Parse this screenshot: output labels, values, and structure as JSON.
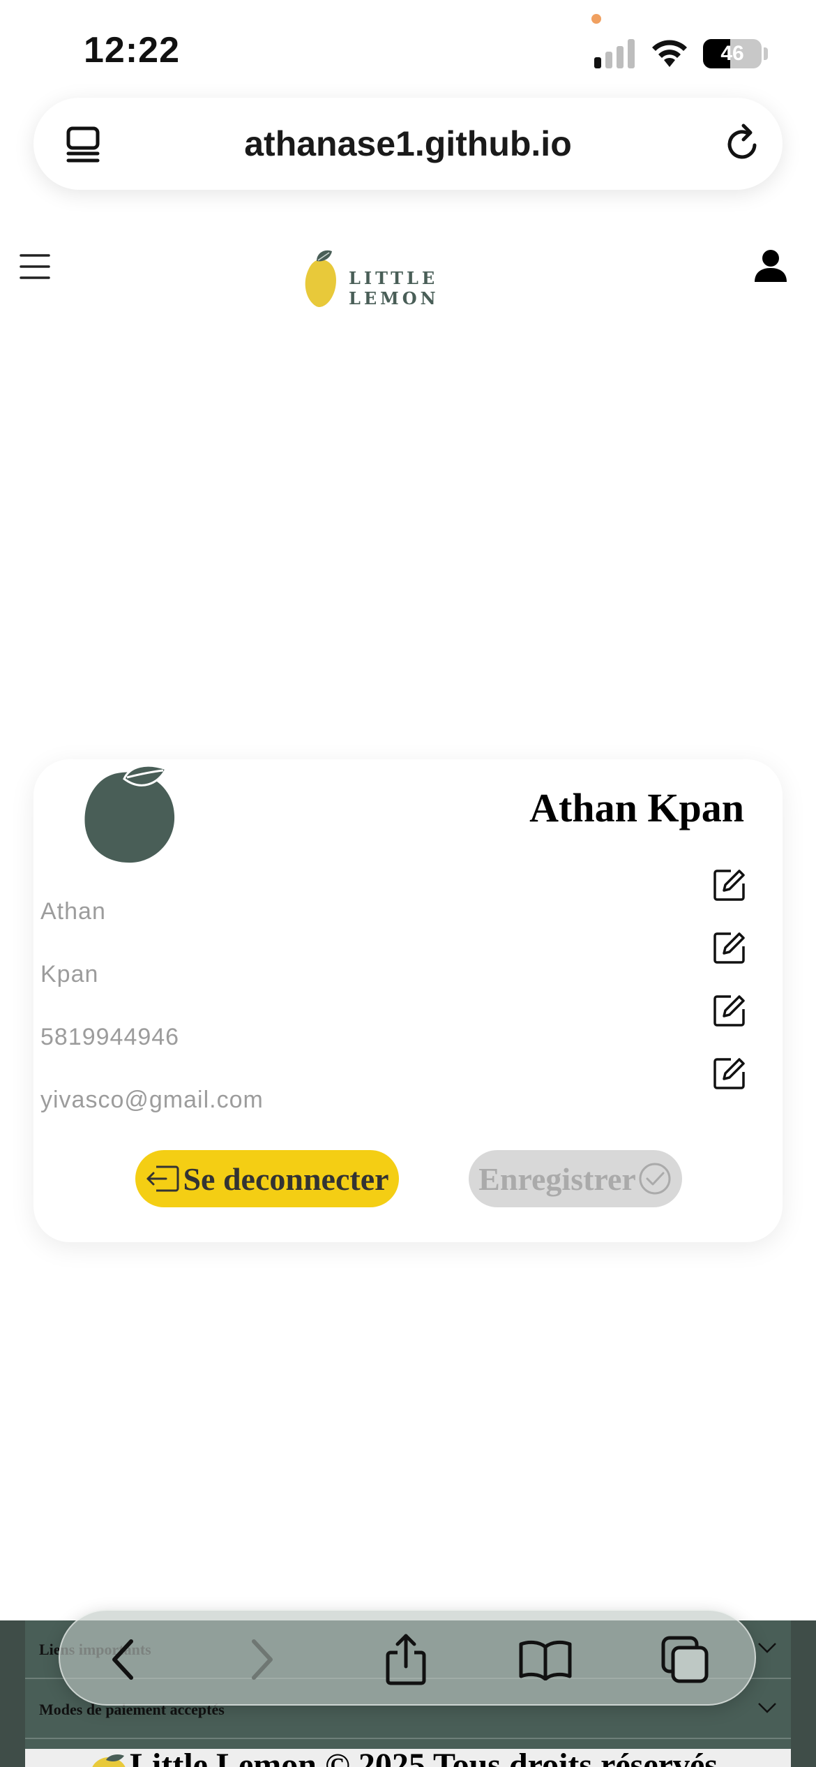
{
  "status_bar": {
    "time": "12:22",
    "battery": "46",
    "battery_level": 0.46,
    "accent_dot_color": "#f0a060"
  },
  "browser": {
    "url": "athanase1.github.io"
  },
  "site": {
    "logo_text": "LITTLE LEMON",
    "brand_colors": {
      "primary": "#495e57",
      "yellow": "#f4ce14"
    }
  },
  "profile": {
    "display_name": "Athan Kpan",
    "fields": [
      {
        "name": "first-name",
        "value": "Athan"
      },
      {
        "name": "last-name",
        "value": "Kpan"
      },
      {
        "name": "phone",
        "value": "5819944946"
      },
      {
        "name": "email",
        "value": "yivasco@gmail.com"
      }
    ],
    "logout_label": "Se deconnecter",
    "save_label": "Enregistrer"
  },
  "footer": {
    "rows": [
      {
        "label": "Liens importants"
      },
      {
        "label": "Modes de paiement acceptés"
      }
    ],
    "copyright": "Little Lemon © 2025    Tous droits réservés"
  },
  "icons": {
    "menu": "hamburger-icon",
    "user": "user-icon",
    "edit": "edit-icon",
    "logout": "logout-icon",
    "save": "check-circle-icon",
    "toolbar": [
      "back-icon",
      "forward-icon",
      "share-icon",
      "bookmarks-icon",
      "tabs-icon"
    ]
  }
}
